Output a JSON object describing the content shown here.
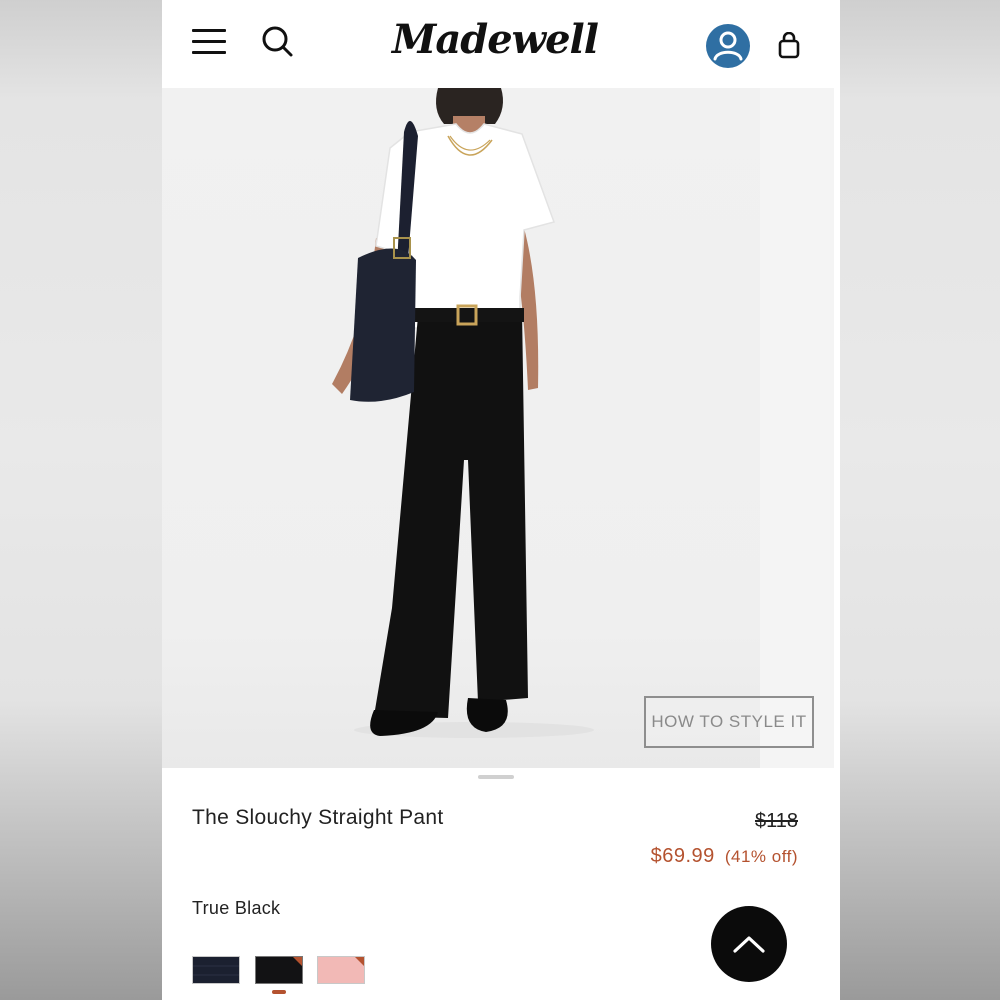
{
  "header": {
    "brand": "Madewell",
    "icons": {
      "menu": "hamburger-menu-icon",
      "search": "search-icon",
      "account": "account-icon",
      "bag": "shopping-bag-icon"
    },
    "account_color": "#2f6fa3"
  },
  "product": {
    "title": "The Slouchy Straight Pant",
    "original_price": "$118",
    "sale_price": "$69.99",
    "discount": "(41% off)",
    "color_name": "True Black",
    "how_to_style_label": "HOW TO STYLE IT",
    "swatches": [
      {
        "name": "navy",
        "color": "#1b2030"
      },
      {
        "name": "true-black",
        "color": "#121214",
        "selected": true
      },
      {
        "name": "pink",
        "color": "#f2b9b6"
      }
    ]
  },
  "colors": {
    "sale": "#b4522f",
    "text": "#222222"
  }
}
